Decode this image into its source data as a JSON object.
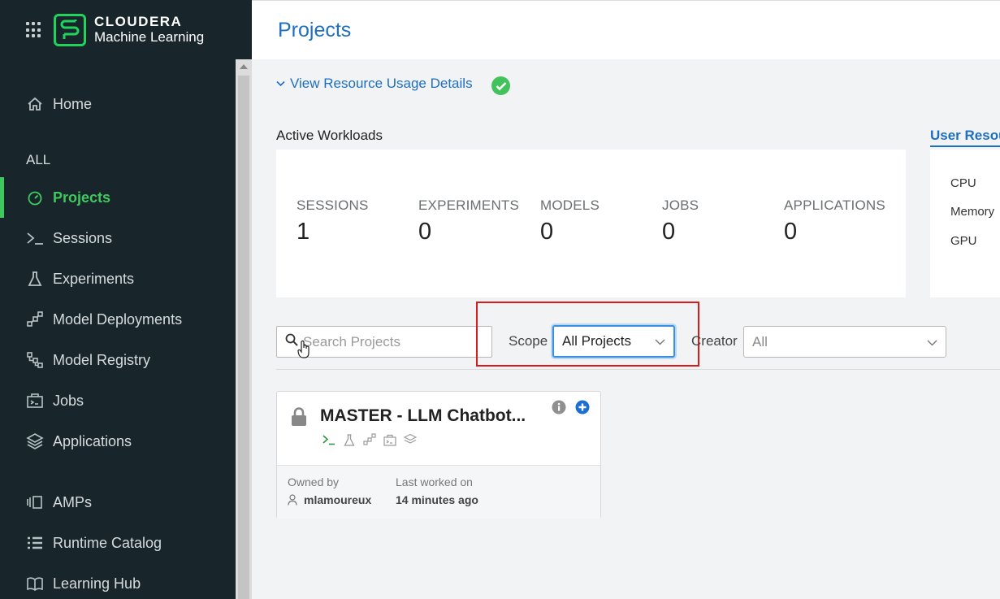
{
  "brand": {
    "line1": "CLOUDERA",
    "line2": "Machine Learning"
  },
  "nav": {
    "home": "Home",
    "section": "ALL",
    "projects": "Projects",
    "sessions": "Sessions",
    "experiments": "Experiments",
    "model_deployments": "Model Deployments",
    "model_registry": "Model Registry",
    "jobs": "Jobs",
    "applications": "Applications",
    "amps": "AMPs",
    "runtime_catalog": "Runtime Catalog",
    "learning_hub": "Learning Hub"
  },
  "header": {
    "title": "Projects"
  },
  "resource_link": "View Resource Usage Details",
  "active_workloads": {
    "title": "Active Workloads",
    "stats": [
      {
        "label": "SESSIONS",
        "value": "1"
      },
      {
        "label": "EXPERIMENTS",
        "value": "0"
      },
      {
        "label": "MODELS",
        "value": "0"
      },
      {
        "label": "JOBS",
        "value": "0"
      },
      {
        "label": "APPLICATIONS",
        "value": "0"
      }
    ]
  },
  "user_resources": {
    "tab": "User Resou",
    "rows": [
      "CPU",
      "Memory",
      "GPU"
    ]
  },
  "filters": {
    "search_placeholder": "Search Projects",
    "scope_label": "Scope",
    "scope_value": "All Projects",
    "creator_label": "Creator",
    "creator_value": "All"
  },
  "project": {
    "title": "MASTER - LLM Chatbot...",
    "owned_by_label": "Owned by",
    "owner": "mlamoureux",
    "last_worked_label": "Last worked on",
    "last_worked": "14 minutes ago"
  },
  "colors": {
    "accent_green": "#3ec95e",
    "link_blue": "#1f6fbf",
    "sidebar_bg": "#18262b",
    "highlight_red": "#d91b1b"
  }
}
